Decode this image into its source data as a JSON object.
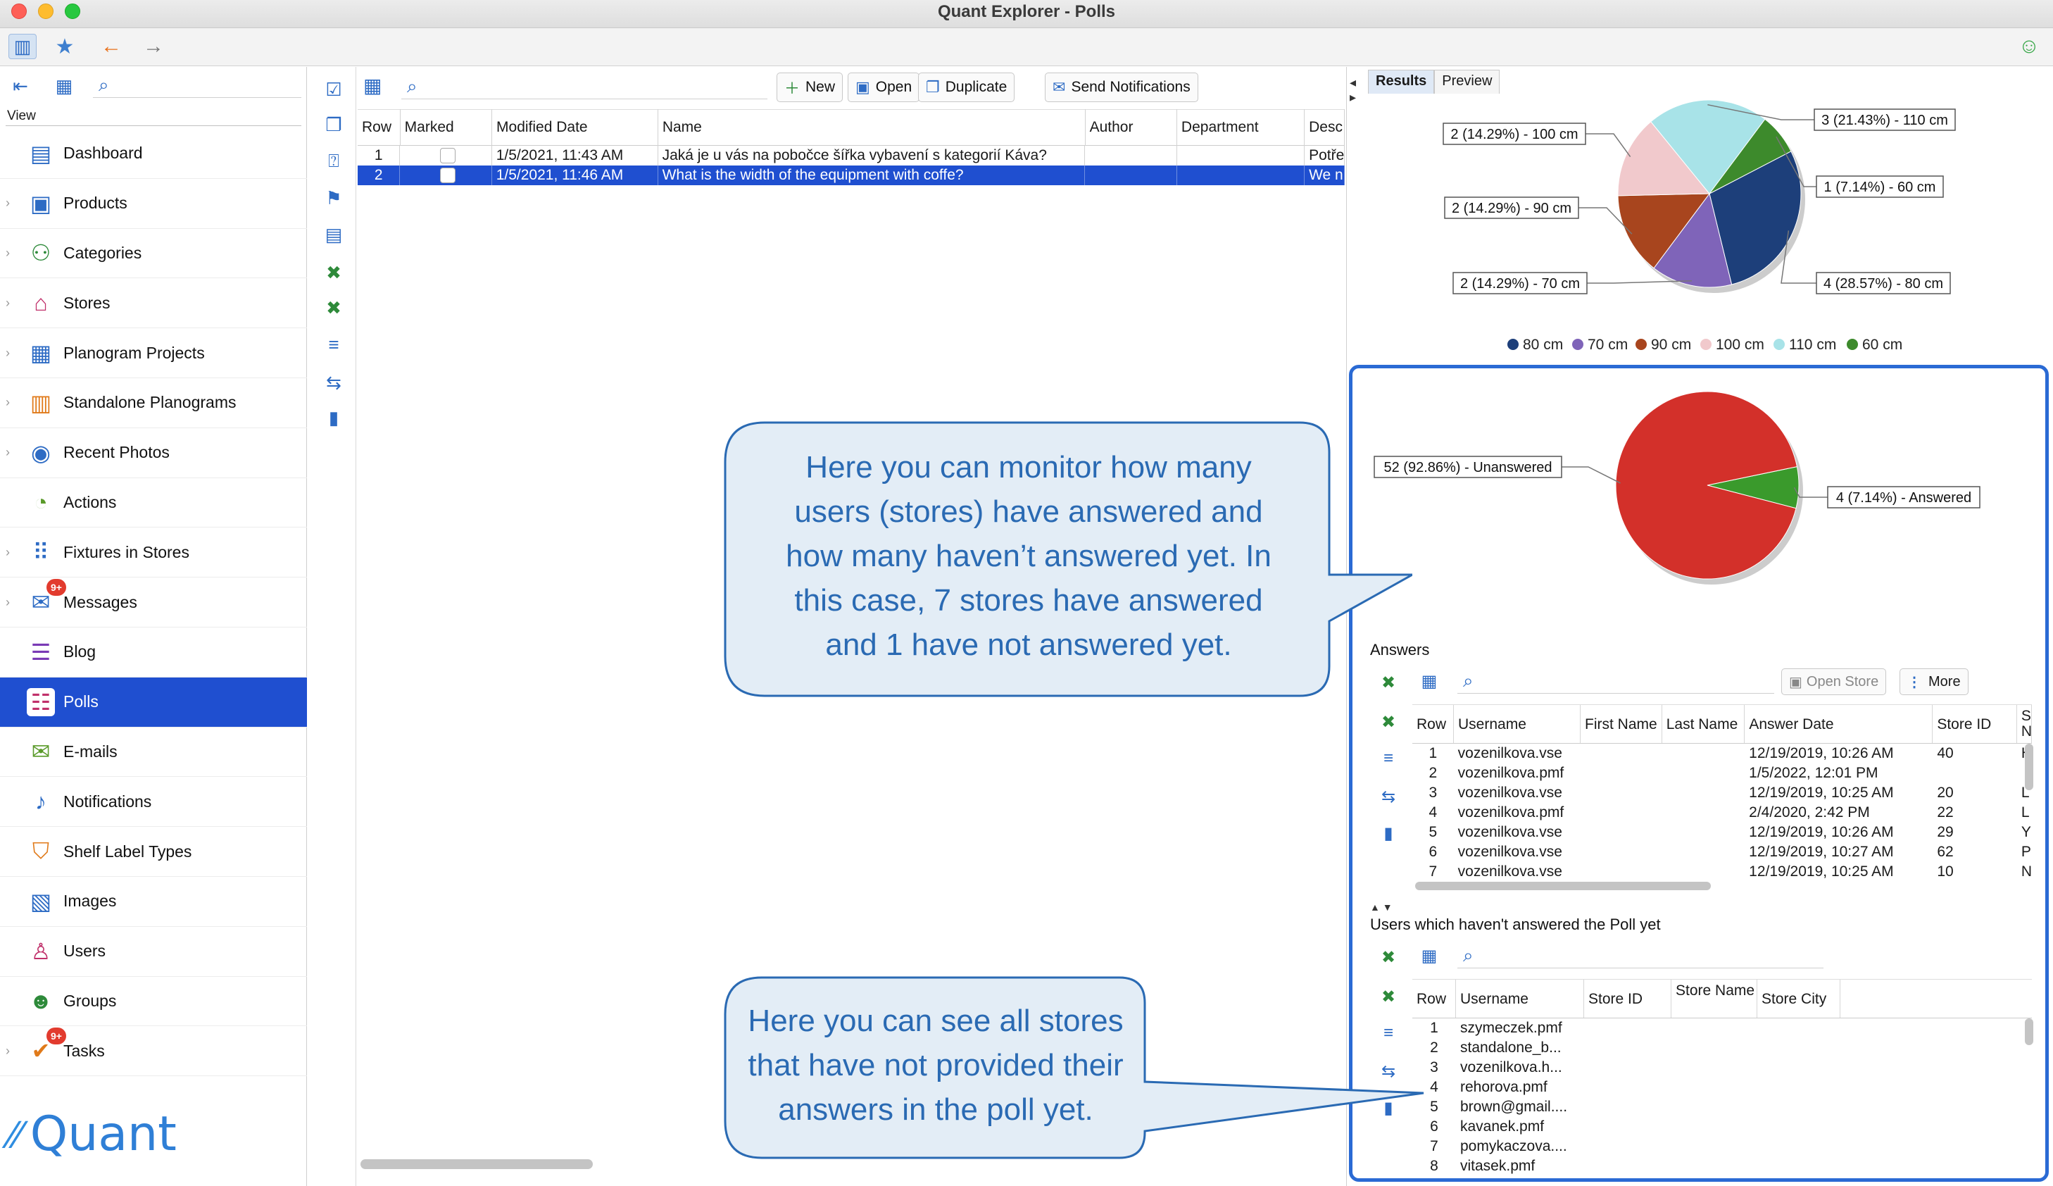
{
  "window": {
    "title": "Quant Explorer - Polls"
  },
  "toolbar": {
    "icons": [
      "sidebar-toggle-icon",
      "star-icon",
      "back-arrow-icon",
      "forward-arrow-icon",
      "smiley-icon"
    ]
  },
  "sidebar": {
    "view_label": "View",
    "items": [
      {
        "label": "Dashboard",
        "icon": "dashboard-icon",
        "expandable": false
      },
      {
        "label": "Products",
        "icon": "products-icon",
        "expandable": true
      },
      {
        "label": "Categories",
        "icon": "categories-icon",
        "expandable": true
      },
      {
        "label": "Stores",
        "icon": "stores-icon",
        "expandable": true
      },
      {
        "label": "Planogram Projects",
        "icon": "planogram-projects-icon",
        "expandable": true
      },
      {
        "label": "Standalone Planograms",
        "icon": "standalone-planograms-icon",
        "expandable": true
      },
      {
        "label": "Recent Photos",
        "icon": "camera-icon",
        "expandable": true
      },
      {
        "label": "Actions",
        "icon": "actions-icon",
        "expandable": false
      },
      {
        "label": "Fixtures in Stores",
        "icon": "fixtures-icon",
        "expandable": true
      },
      {
        "label": "Messages",
        "icon": "messages-icon",
        "expandable": true,
        "badge": "9+"
      },
      {
        "label": "Blog",
        "icon": "blog-icon",
        "expandable": false
      },
      {
        "label": "Polls",
        "icon": "polls-icon",
        "expandable": false,
        "active": true
      },
      {
        "label": "E-mails",
        "icon": "email-icon",
        "expandable": false
      },
      {
        "label": "Notifications",
        "icon": "notifications-icon",
        "expandable": false
      },
      {
        "label": "Shelf Label Types",
        "icon": "shelf-label-icon",
        "expandable": false
      },
      {
        "label": "Images",
        "icon": "images-icon",
        "expandable": false
      },
      {
        "label": "Users",
        "icon": "users-icon",
        "expandable": false
      },
      {
        "label": "Groups",
        "icon": "groups-icon",
        "expandable": false
      },
      {
        "label": "Tasks",
        "icon": "tasks-icon",
        "expandable": true,
        "badge": "9+"
      }
    ],
    "logo_text": "Quant"
  },
  "polls": {
    "buttons": {
      "new": "New",
      "open": "Open",
      "duplicate": "Duplicate",
      "send": "Send Notifications"
    },
    "columns": [
      "Row",
      "Marked",
      "Modified Date",
      "Name",
      "Author",
      "Department",
      "Desc"
    ],
    "rows": [
      {
        "row": "1",
        "modified": "1/5/2021, 11:43 AM",
        "name": "Jaká je u vás na pobočce šířka vybavení s kategorií Káva?",
        "author": "",
        "department": "",
        "desc": "Potře"
      },
      {
        "row": "2",
        "modified": "1/5/2021, 11:46 AM",
        "name": "What is the width of the equipment with coffe?",
        "author": "",
        "department": "",
        "desc": "We n"
      }
    ]
  },
  "results": {
    "tabs": [
      "Results",
      "Preview"
    ]
  },
  "chart_data": [
    {
      "type": "pie",
      "title": "",
      "categories": [
        "80 cm",
        "70 cm",
        "90 cm",
        "100 cm",
        "110 cm",
        "60 cm"
      ],
      "values": [
        4,
        2,
        2,
        2,
        3,
        1
      ],
      "percent": [
        "28.57%",
        "14.29%",
        "14.29%",
        "14.29%",
        "21.43%",
        "7.14%"
      ],
      "colors": [
        "#1d3f7a",
        "#7f64b9",
        "#a8451e",
        "#f1c9cc",
        "#a8e3e8",
        "#3d8a2c"
      ],
      "labels": [
        "4 (28.57%) - 80 cm",
        "2 (14.29%) - 70 cm",
        "2 (14.29%) - 90 cm",
        "2 (14.29%) - 100 cm",
        "3 (21.43%) - 110 cm",
        "1 (7.14%) - 60 cm"
      ],
      "legend": [
        "80 cm",
        "70 cm",
        "90 cm",
        "100 cm",
        "110 cm",
        "60 cm"
      ],
      "legend_position": "bottom"
    },
    {
      "type": "pie",
      "title": "",
      "categories": [
        "Answered",
        "Unanswered"
      ],
      "values": [
        4,
        52
      ],
      "percent": [
        "7.14%",
        "92.86%"
      ],
      "colors": [
        "#3a9a2c",
        "#d3302a"
      ],
      "labels": [
        "4 (7.14%) - Answered",
        "52 (92.86%) - Unanswered"
      ],
      "legend": [
        "Answered",
        "Unanswered"
      ],
      "legend_position": "bottom"
    }
  ],
  "answers": {
    "title": "Answers",
    "buttons": {
      "open_store": "Open Store",
      "more": "More"
    },
    "columns": [
      "Row",
      "Username",
      "First Name",
      "Last Name",
      "Answer Date",
      "Store ID",
      "S N"
    ],
    "rows": [
      [
        "1",
        "vozenilkova.vse",
        "",
        "",
        "12/19/2019, 10:26 AM",
        "40",
        "H"
      ],
      [
        "2",
        "vozenilkova.pmf",
        "",
        "",
        "1/5/2022, 12:01 PM",
        "",
        ""
      ],
      [
        "3",
        "vozenilkova.vse",
        "",
        "",
        "12/19/2019, 10:25 AM",
        "20",
        "L"
      ],
      [
        "4",
        "vozenilkova.pmf",
        "",
        "",
        "2/4/2020, 2:42 PM",
        "22",
        "L"
      ],
      [
        "5",
        "vozenilkova.vse",
        "",
        "",
        "12/19/2019, 10:26 AM",
        "29",
        "Y"
      ],
      [
        "6",
        "vozenilkova.vse",
        "",
        "",
        "12/19/2019, 10:27 AM",
        "62",
        "P"
      ],
      [
        "7",
        "vozenilkova.vse",
        "",
        "",
        "12/19/2019, 10:25 AM",
        "10",
        "N"
      ]
    ]
  },
  "unanswered": {
    "title": "Users which haven't answered the Poll yet",
    "columns": [
      "Row",
      "Username",
      "Store ID",
      "Store Name",
      "Store City"
    ],
    "rows": [
      [
        "1",
        "szymeczek.pmf",
        "",
        "",
        ""
      ],
      [
        "2",
        "standalone_b...",
        "",
        "",
        ""
      ],
      [
        "3",
        "vozenilkova.h...",
        "",
        "",
        ""
      ],
      [
        "4",
        "rehorova.pmf",
        "",
        "",
        ""
      ],
      [
        "5",
        "brown@gmail....",
        "",
        "",
        ""
      ],
      [
        "6",
        "kavanek.pmf",
        "",
        "",
        ""
      ],
      [
        "7",
        "pomykaczova....",
        "",
        "",
        ""
      ],
      [
        "8",
        "vitasek.pmf",
        "",
        "",
        ""
      ]
    ]
  },
  "callouts": {
    "monitor": [
      "Here you can monitor how many",
      "users (stores) have answered and",
      "how many haven’t answered yet. In",
      "this case, 7 stores have answered",
      "and 1 have not answered yet."
    ],
    "stores": [
      "Here you can see all stores",
      "that have not provided their",
      "answers in the poll yet."
    ]
  }
}
